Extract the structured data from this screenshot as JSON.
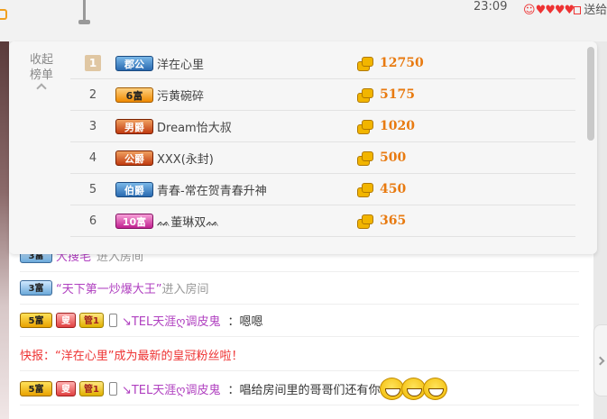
{
  "topbar": {
    "time": "23:09",
    "status_smile": "☺",
    "status_hearts": "♥♥♥♥",
    "status_label": "送给"
  },
  "ranking": {
    "collapse_label_line1": "收起",
    "collapse_label_line2": "榜单",
    "rows": [
      {
        "rank": "1",
        "badge": "郡公",
        "name": "洋在心里",
        "score": "12750"
      },
      {
        "rank": "2",
        "badge": "6富",
        "name": "污黄碗碎",
        "score": "5175"
      },
      {
        "rank": "3",
        "badge": "男爵",
        "name": "Dream怡大叔",
        "score": "1020"
      },
      {
        "rank": "4",
        "badge": "公爵",
        "name": "XXX(永封)",
        "score": "500"
      },
      {
        "rank": "5",
        "badge": "伯爵",
        "name": "青春-常在贺青春升神",
        "score": "450"
      },
      {
        "rank": "6",
        "badge": "10富",
        "name": "ᨐ董琳双ᨐ",
        "score": "365"
      }
    ]
  },
  "chat": {
    "msg1": {
      "level": "3富",
      "user": "大搜毛",
      "text": "进入房间"
    },
    "msg2": {
      "level": "3富",
      "user": "“天下第一炒爆大王”",
      "text": "进入房间"
    },
    "msg3": {
      "level": "5富",
      "tag1": "叟",
      "tag2": "管1",
      "user": "↘TEL天涯ღ调皮鬼",
      "text": "：嗯嗯"
    },
    "msg4": {
      "prefix": "快报：",
      "user": "“洋在心里”",
      "text": "成为最新的皇冠粉丝啦！"
    },
    "msg5": {
      "level": "5富",
      "tag1": "叟",
      "tag2": "管1",
      "user": "↘TEL天涯ღ调皮鬼",
      "text": "：唱给房间里的哥哥们还有你"
    }
  }
}
